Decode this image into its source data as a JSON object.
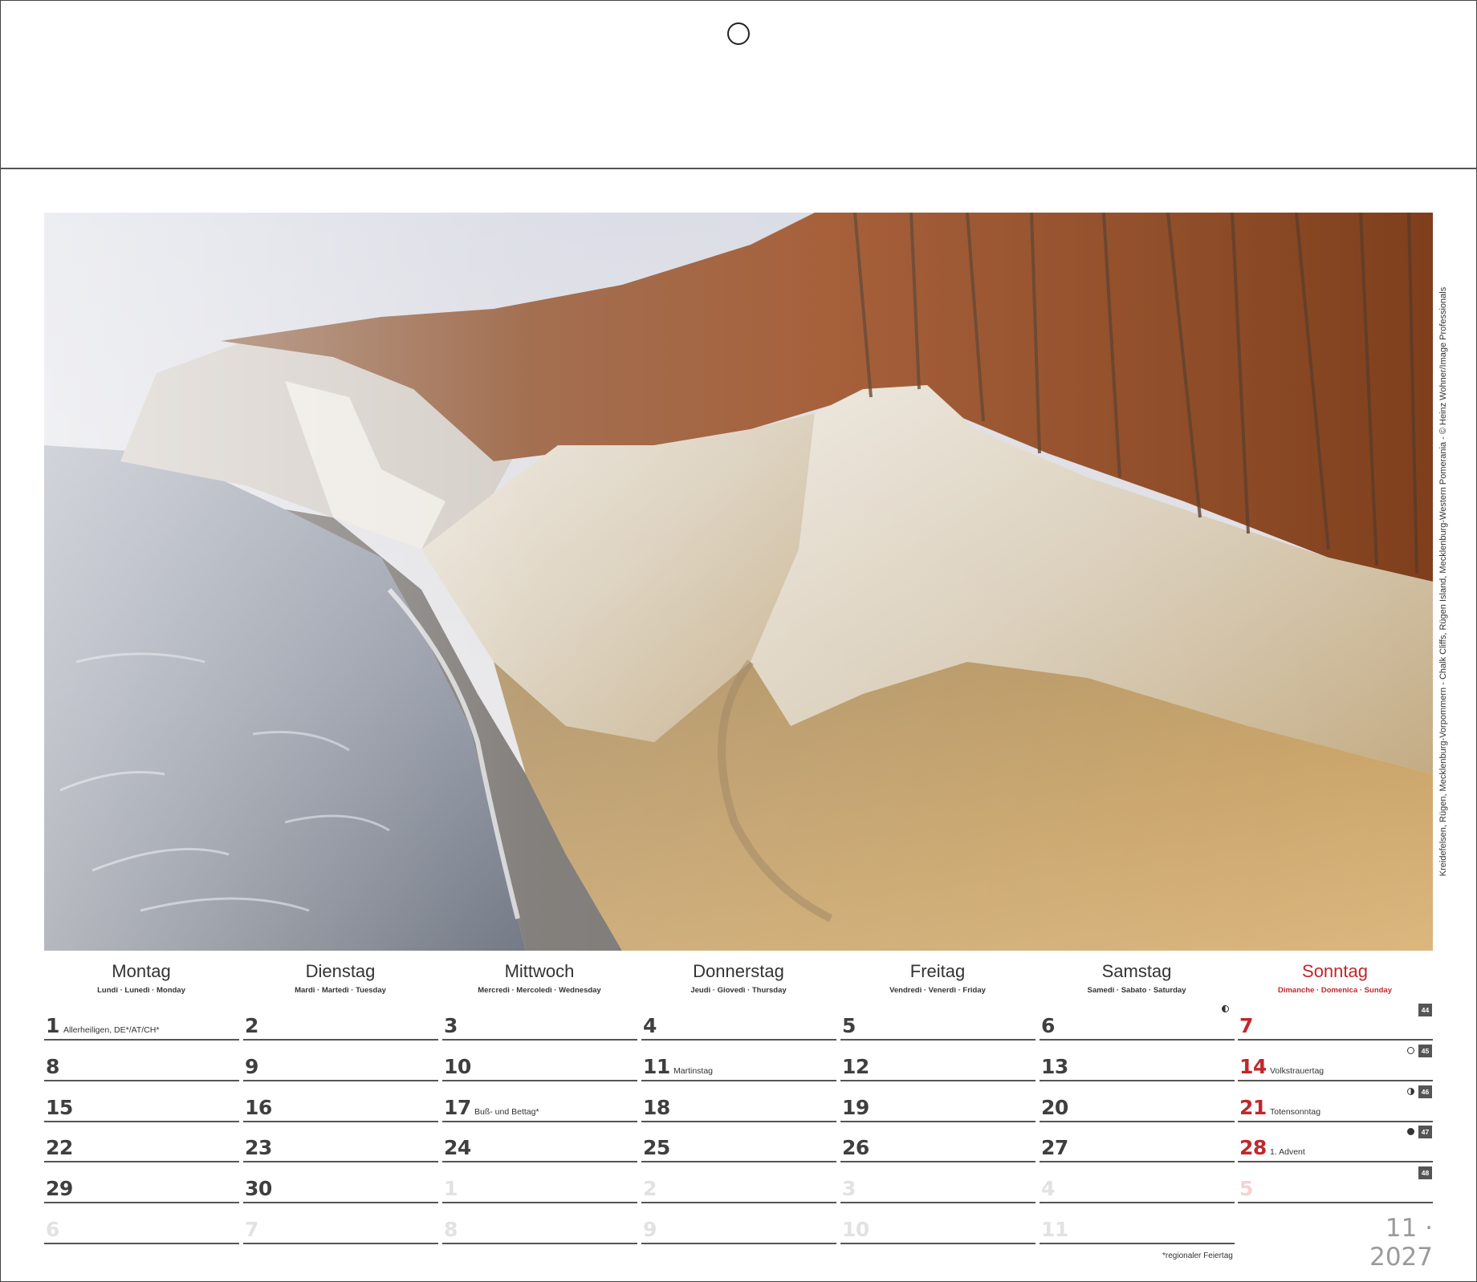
{
  "photo": {
    "caption": "Kreidefelsen, Rügen, Mecklenburg-Vorpommern - Chalk Cliffs, Rügen Island, Mecklenburg-Western Pomerania - © Heinz Wohner/Image Professionals"
  },
  "weekdays": [
    {
      "name": "Montag",
      "sub": "Lundi · Lunedì · Monday"
    },
    {
      "name": "Dienstag",
      "sub": "Mardi · Martedì · Tuesday"
    },
    {
      "name": "Mittwoch",
      "sub": "Mercredi · Mercoledì · Wednesday"
    },
    {
      "name": "Donnerstag",
      "sub": "Jeudi · Giovedì · Thursday"
    },
    {
      "name": "Freitag",
      "sub": "Vendredi · Venerdì · Friday"
    },
    {
      "name": "Samstag",
      "sub": "Samedi · Sabato · Saturday"
    },
    {
      "name": "Sonntag",
      "sub": "Dimanche · Domenica · Sunday"
    }
  ],
  "weeks": [
    {
      "week_number": "44",
      "moon": "half-l",
      "days": [
        {
          "num": "1",
          "note": "Allerheiligen, DE*/AT/CH*"
        },
        {
          "num": "2"
        },
        {
          "num": "3"
        },
        {
          "num": "4"
        },
        {
          "num": "5"
        },
        {
          "num": "6"
        },
        {
          "num": "7"
        }
      ]
    },
    {
      "week_number": "45",
      "moon": "full",
      "days": [
        {
          "num": "8"
        },
        {
          "num": "9"
        },
        {
          "num": "10"
        },
        {
          "num": "11",
          "note": "Martinstag"
        },
        {
          "num": "12"
        },
        {
          "num": "13"
        },
        {
          "num": "14",
          "note": "Volkstrauertag"
        }
      ]
    },
    {
      "week_number": "46",
      "moon": "half-r",
      "days": [
        {
          "num": "15"
        },
        {
          "num": "16"
        },
        {
          "num": "17",
          "note": "Buß- und Bettag*"
        },
        {
          "num": "18"
        },
        {
          "num": "19"
        },
        {
          "num": "20"
        },
        {
          "num": "21",
          "note": "Totensonntag"
        }
      ]
    },
    {
      "week_number": "47",
      "moon": "new",
      "days": [
        {
          "num": "22"
        },
        {
          "num": "23"
        },
        {
          "num": "24"
        },
        {
          "num": "25"
        },
        {
          "num": "26"
        },
        {
          "num": "27"
        },
        {
          "num": "28",
          "note": "1. Advent"
        }
      ]
    },
    {
      "week_number": "48",
      "days": [
        {
          "num": "29"
        },
        {
          "num": "30"
        },
        {
          "num": "1",
          "faded": true
        },
        {
          "num": "2",
          "faded": true
        },
        {
          "num": "3",
          "faded": true
        },
        {
          "num": "4",
          "faded": true
        },
        {
          "num": "5",
          "faded": true
        }
      ]
    },
    {
      "days": [
        {
          "num": "6",
          "faded": true
        },
        {
          "num": "7",
          "faded": true
        },
        {
          "num": "8",
          "faded": true
        },
        {
          "num": "9",
          "faded": true
        },
        {
          "num": "10",
          "faded": true
        },
        {
          "num": "11",
          "faded": true
        }
      ]
    }
  ],
  "footnote": "*regionaler Feiertag",
  "month_year": "11 · 2027",
  "colors": {
    "sunday": "#c0282b",
    "ink": "#3f3f3f",
    "faded": "#e2e2e2",
    "rule": "#555555"
  }
}
